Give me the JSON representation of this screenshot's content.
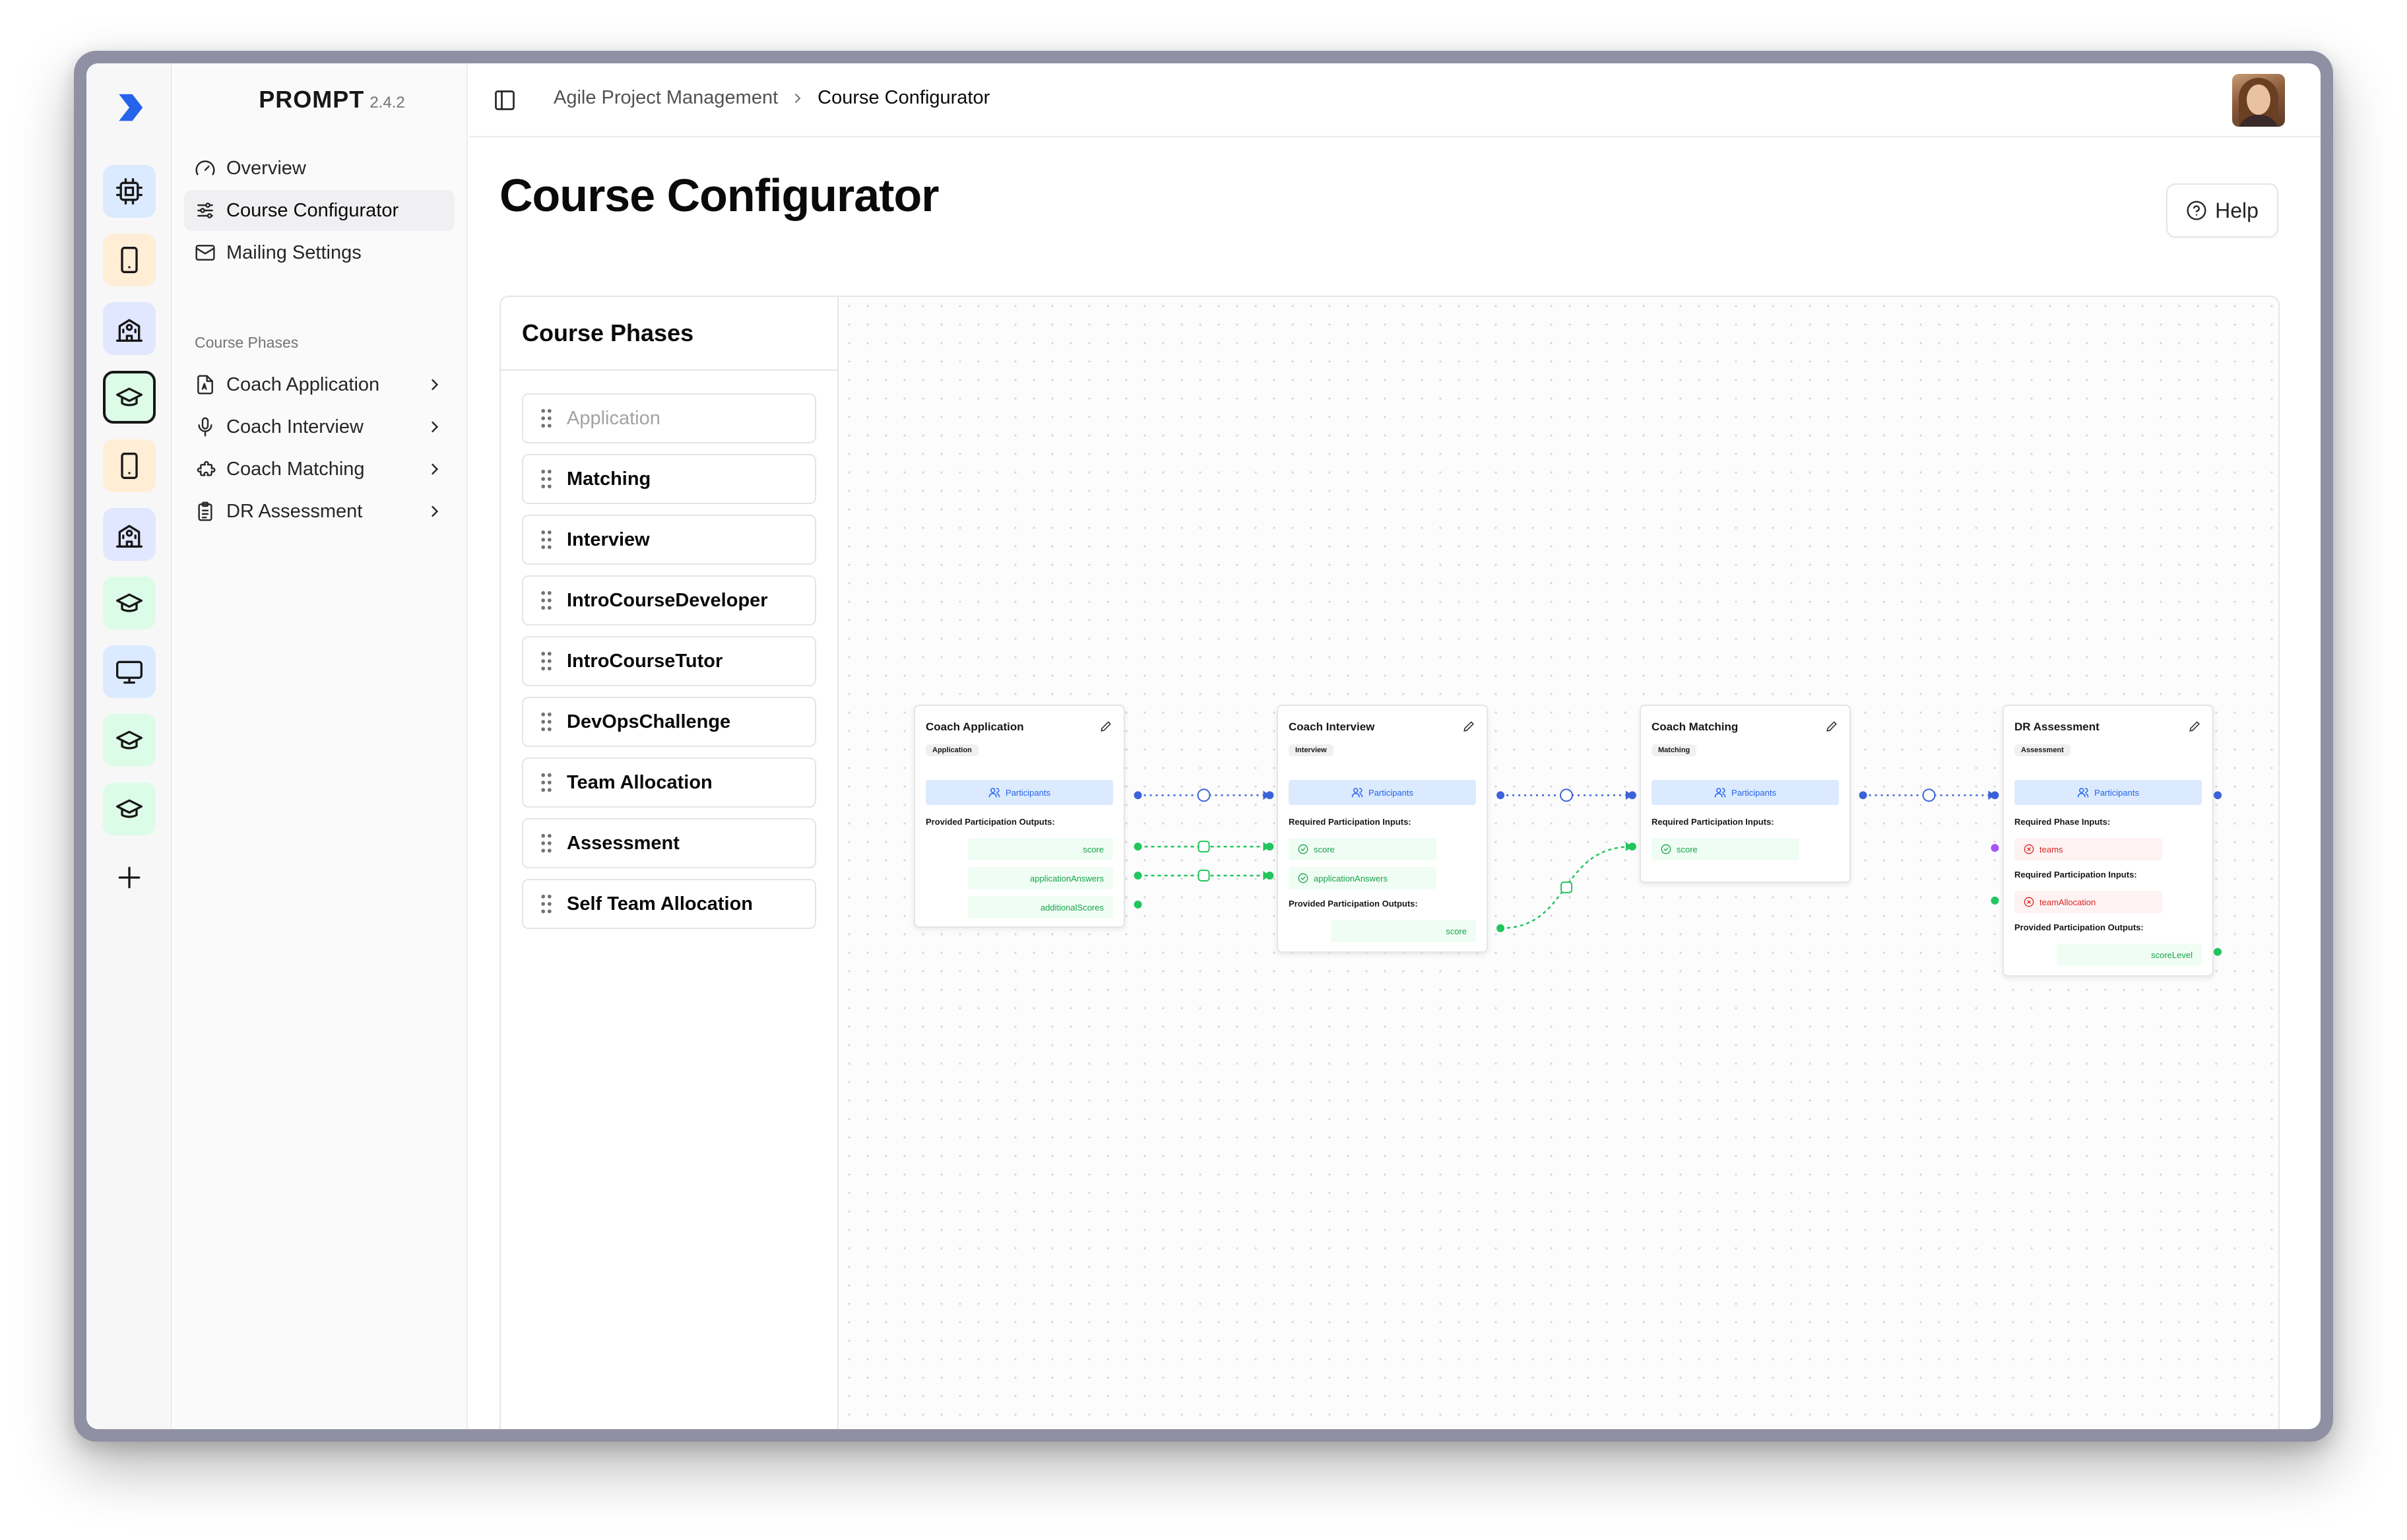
{
  "app": {
    "name": "PROMPT",
    "version": "2.4.2"
  },
  "rail": {
    "buttons": [
      {
        "icon": "cpu-icon",
        "color": "blue"
      },
      {
        "icon": "tablet-icon",
        "color": "orange"
      },
      {
        "icon": "school-icon",
        "color": "indigo"
      },
      {
        "icon": "graduation-cap-icon",
        "color": "green",
        "active": true
      },
      {
        "icon": "tablet-icon",
        "color": "orange"
      },
      {
        "icon": "school-icon",
        "color": "indigo"
      },
      {
        "icon": "graduation-cap-icon",
        "color": "green"
      },
      {
        "icon": "monitor-icon",
        "color": "blue"
      },
      {
        "icon": "graduation-cap-icon",
        "color": "green"
      },
      {
        "icon": "graduation-cap-icon",
        "color": "green"
      },
      {
        "icon": "plus-icon",
        "color": "none"
      }
    ]
  },
  "nav": {
    "items": [
      {
        "label": "Overview",
        "icon": "gauge-icon"
      },
      {
        "label": "Course Configurator",
        "icon": "sliders-icon",
        "selected": true
      },
      {
        "label": "Mailing Settings",
        "icon": "mail-icon"
      }
    ],
    "section_title": "Course Phases",
    "phases": [
      {
        "label": "Coach Application",
        "icon": "file-icon"
      },
      {
        "label": "Coach Interview",
        "icon": "mic-icon"
      },
      {
        "label": "Coach Matching",
        "icon": "puzzle-icon"
      },
      {
        "label": "DR Assessment",
        "icon": "clipboard-icon"
      }
    ]
  },
  "breadcrumb": {
    "parent": "Agile Project Management",
    "current": "Course Configurator"
  },
  "page": {
    "title": "Course Configurator",
    "help_label": "Help"
  },
  "phase_list": {
    "title": "Course Phases",
    "items": [
      "Application",
      "Matching",
      "Interview",
      "IntroCourseDeveloper",
      "IntroCourseTutor",
      "DevOpsChallenge",
      "Team Allocation",
      "Assessment",
      "Self Team Allocation"
    ],
    "disabled": [
      "Application"
    ]
  },
  "nodes": [
    {
      "title": "Coach Application",
      "tag": "Application",
      "participants": "Participants",
      "provided_label": "Provided Participation Outputs:",
      "outputs": [
        "score",
        "applicationAnswers",
        "additionalScores"
      ]
    },
    {
      "title": "Coach Interview",
      "tag": "Interview",
      "participants": "Participants",
      "required_label": "Required Participation Inputs:",
      "inputs": [
        "score",
        "applicationAnswers"
      ],
      "provided_label": "Provided Participation Outputs:",
      "outputs": [
        "score"
      ]
    },
    {
      "title": "Coach Matching",
      "tag": "Matching",
      "participants": "Participants",
      "required_label": "Required Participation Inputs:",
      "inputs": [
        "score"
      ]
    },
    {
      "title": "DR Assessment",
      "tag": "Assessment",
      "participants": "Participants",
      "phase_inputs_label": "Required Phase Inputs:",
      "phase_inputs": [
        "teams"
      ],
      "required_label": "Required Participation Inputs:",
      "inputs": [
        "teamAllocation"
      ],
      "provided_label": "Provided Participation Outputs:",
      "outputs": [
        "scoreLevel"
      ]
    }
  ],
  "colors": {
    "edge_participants": "#3b63d9",
    "edge_data": "#22c55e",
    "missing": "#dc2626",
    "phase_handle": "#a855f7"
  }
}
